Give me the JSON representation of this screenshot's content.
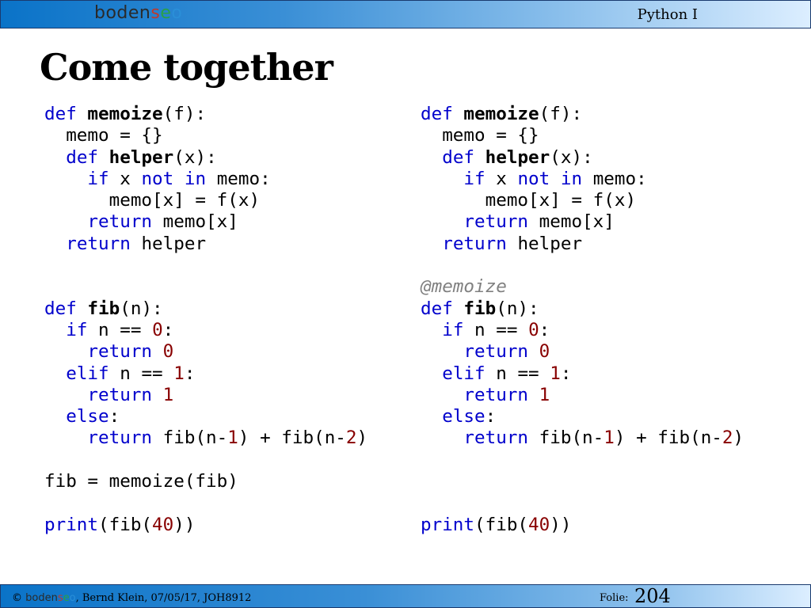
{
  "header": {
    "logo": {
      "part1": "boden",
      "part2": "s",
      "part3": "e",
      "part4": "o"
    },
    "course": "Python I"
  },
  "slide": {
    "title": "Come together"
  },
  "code_left": {
    "lines": [
      "def memoize(f):",
      "  memo = {}",
      "  def helper(x):",
      "    if x not in memo:",
      "      memo[x] = f(x)",
      "    return memo[x]",
      "  return helper",
      "",
      "",
      "def fib(n):",
      "  if n == 0:",
      "    return 0",
      "  elif n == 1:",
      "    return 1",
      "  else:",
      "    return fib(n-1) + fib(n-2)",
      "",
      "fib = memoize(fib)",
      "",
      "print(fib(40))"
    ]
  },
  "code_right": {
    "lines": [
      "def memoize(f):",
      "  memo = {}",
      "  def helper(x):",
      "    if x not in memo:",
      "      memo[x] = f(x)",
      "    return memo[x]",
      "  return helper",
      "",
      "@memoize",
      "def fib(n):",
      "  if n == 0:",
      "    return 0",
      "  elif n == 1:",
      "    return 1",
      "  else:",
      "    return fib(n-1) + fib(n-2)",
      "",
      "",
      "",
      "print(fib(40))"
    ]
  },
  "footer": {
    "copyright": "©",
    "author_info": ", Bernd Klein, 07/05/17, JOH8912",
    "folie_label": "Folie:",
    "page_number": "204"
  },
  "colors": {
    "keyword": "#0000cc",
    "number": "#880000",
    "decorator": "#808080",
    "bar_start": "#0a73c8",
    "bar_end": "#dceeff"
  }
}
